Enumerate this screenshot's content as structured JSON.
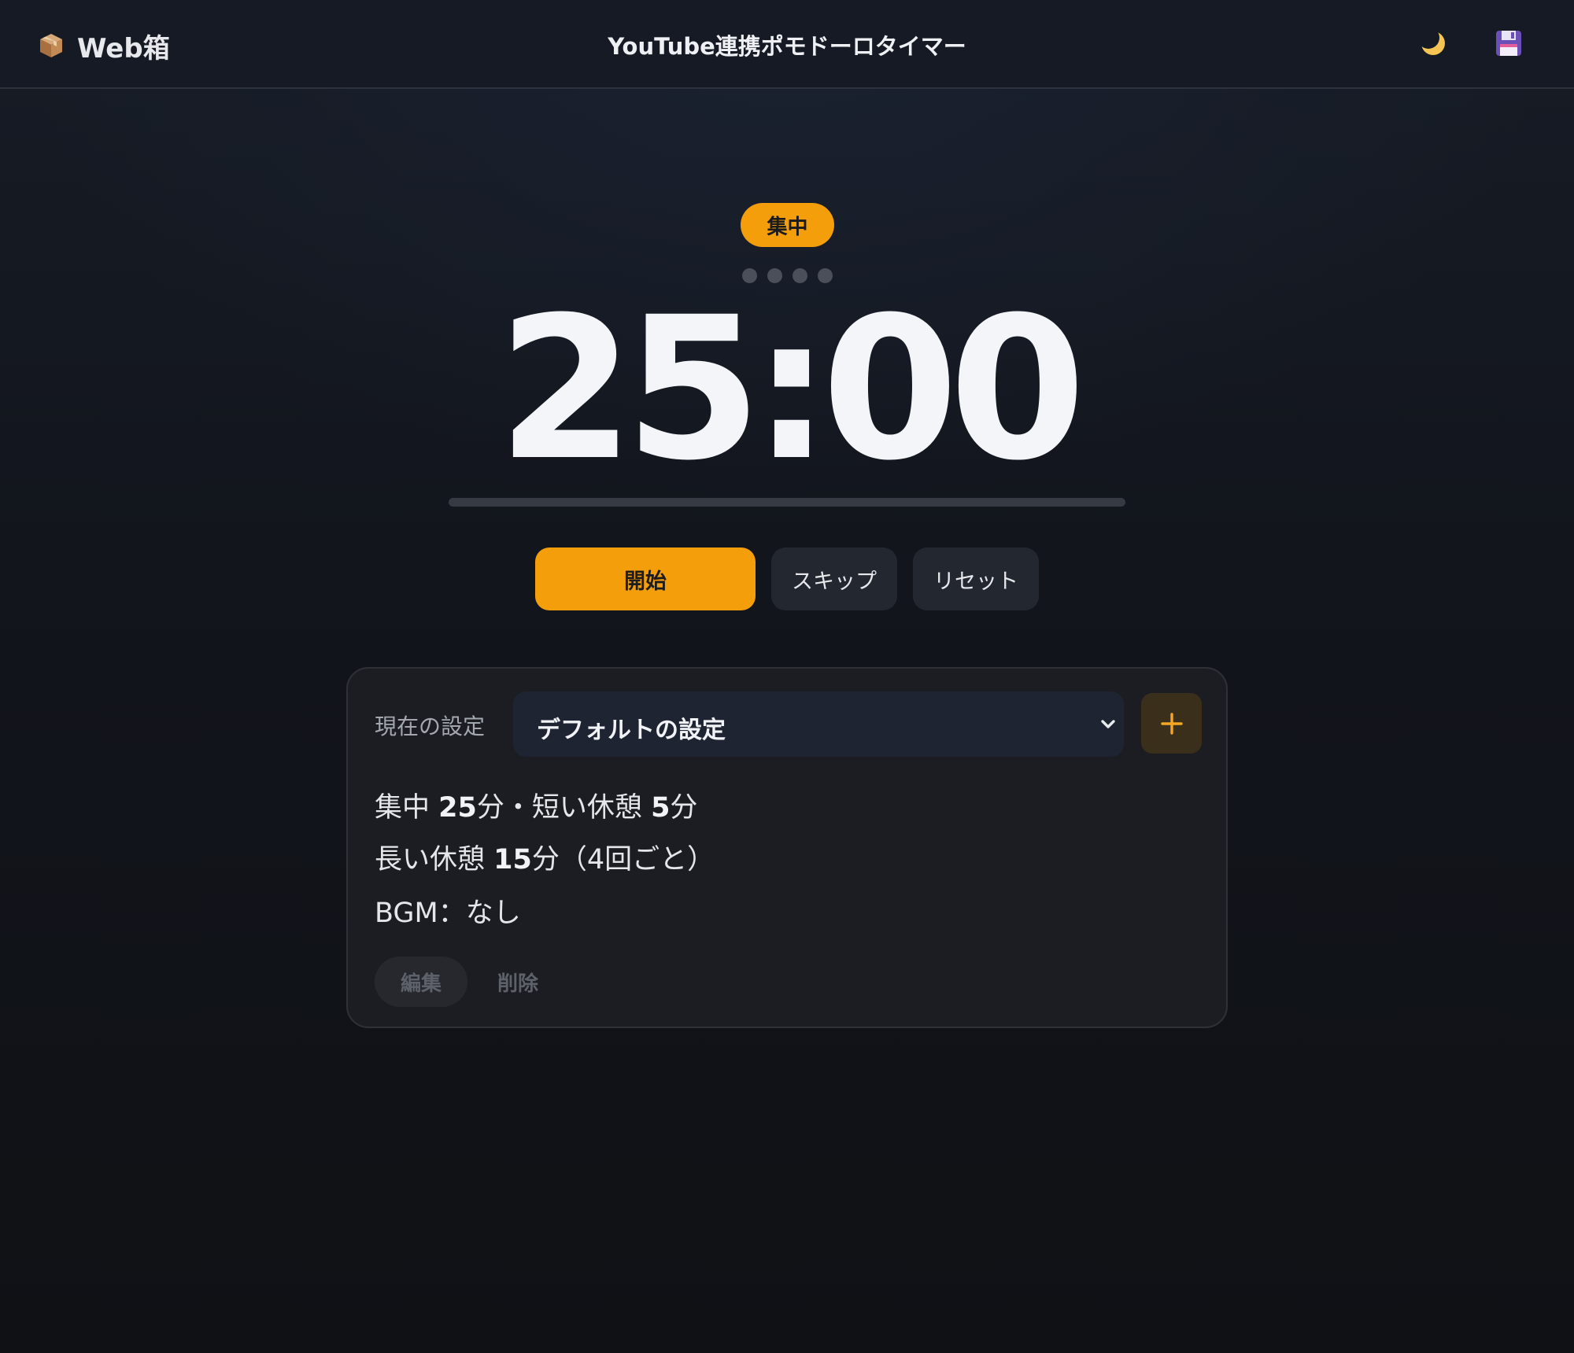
{
  "header": {
    "brand_name": "Web箱",
    "brand_icon": "package-box-icon",
    "title": "YouTube連携ポモドーロタイマー",
    "theme_icon": "crescent-moon-icon",
    "save_icon": "floppy-disk-icon"
  },
  "timer": {
    "phase_label": "集中",
    "cycle_dots": [
      false,
      false,
      false,
      false
    ],
    "time": "25:00",
    "progress": 0
  },
  "controls": {
    "start_label": "開始",
    "skip_label": "スキップ",
    "reset_label": "リセット"
  },
  "settings": {
    "label": "現在の設定",
    "selected_preset": "デフォルトの設定",
    "add_icon": "plus-icon",
    "line1": {
      "focus_label": "集中",
      "focus_value": "25",
      "unit": "分",
      "separator": "・",
      "short_break_label": "短い休憩",
      "short_break_value": "5"
    },
    "line2": {
      "long_break_label": "長い休憩",
      "long_break_value": "15",
      "unit": "分",
      "interval_note": "（4回ごと）"
    },
    "line3": {
      "bgm_text": "BGM：なし"
    },
    "edit_label": "編集",
    "delete_label": "削除"
  },
  "colors": {
    "accent": "#f59e0b",
    "background": "#12151c",
    "card": "#1b1d22",
    "button_dark": "#23272f"
  }
}
